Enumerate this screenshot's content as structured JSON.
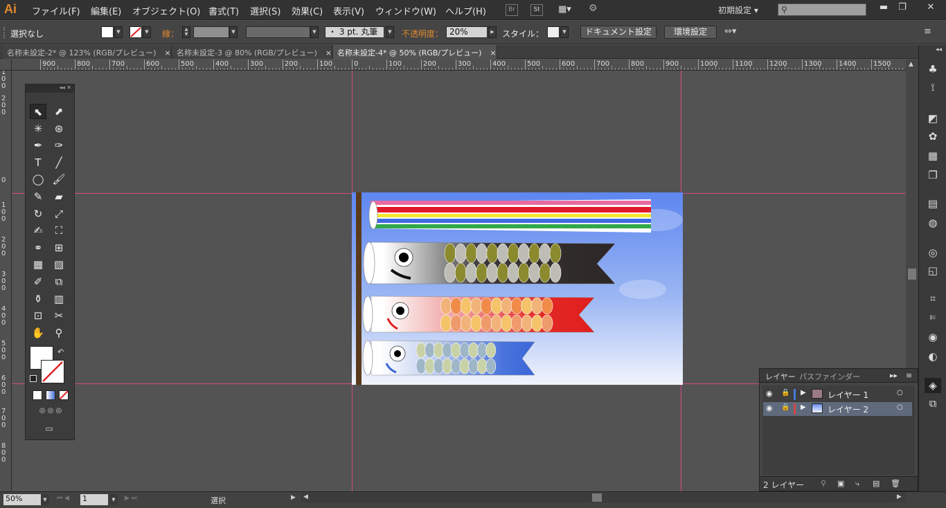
{
  "app": {
    "logo": "Ai"
  },
  "menu": [
    "ファイル(F)",
    "編集(E)",
    "オブジェクト(O)",
    "書式(T)",
    "選択(S)",
    "効果(C)",
    "表示(V)",
    "ウィンドウ(W)",
    "ヘルプ(H)"
  ],
  "menu_icons": {
    "bridge": "Br",
    "stock": "St"
  },
  "workspace": {
    "label": "初期設定 ▾"
  },
  "window_controls": {
    "minimize": "▬",
    "restore": "❐",
    "close": "✕"
  },
  "control": {
    "selection": "選択なし",
    "stroke_label": "線：",
    "brush": "・ 3 pt. 丸筆",
    "opacity_label": "不透明度：",
    "opacity_value": "20%",
    "style_label": "スタイル：",
    "doc_settings": "ドキュメント設定",
    "prefs": "環境設定"
  },
  "tabs": [
    {
      "label": "名称未設定-2* @ 123% (RGB/プレビュー)",
      "close": "×"
    },
    {
      "label": "名称未設定-3 @ 80% (RGB/プレビュー)",
      "close": "×"
    },
    {
      "label": "名称未設定-4* @ 50% (RGB/プレビュー)",
      "close": "×"
    }
  ],
  "ruler": {
    "h": [
      "900",
      "800",
      "700",
      "600",
      "500",
      "400",
      "300",
      "200",
      "100",
      "0",
      "100",
      "200",
      "300",
      "400",
      "500",
      "600",
      "700",
      "800",
      "900",
      "1000",
      "1100",
      "1200",
      "1300",
      "1400",
      "1500"
    ],
    "v": [
      "100",
      "200",
      "0",
      "100",
      "200",
      "300",
      "400",
      "500",
      "600",
      "700",
      "800"
    ]
  },
  "layers_panel": {
    "tab1": "レイヤー",
    "tab2": "パスファインダー",
    "rows": [
      {
        "name": "レイヤー 1",
        "color": "#4a7bd6"
      },
      {
        "name": "レイヤー 2",
        "color": "#d24848"
      }
    ],
    "count": "2 レイヤー"
  },
  "status": {
    "zoom": "50%",
    "artboard": "1",
    "mode": "選択"
  },
  "colors": {
    "accent": "#e08a2e",
    "guide": "#d44a86"
  }
}
